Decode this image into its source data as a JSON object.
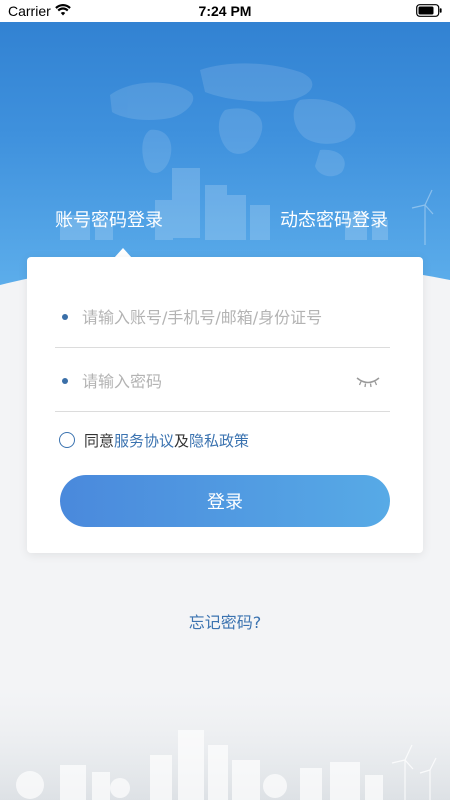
{
  "status_bar": {
    "carrier": "Carrier",
    "time": "7:24 PM"
  },
  "tabs": [
    {
      "label": "账号密码登录",
      "active": true
    },
    {
      "label": "动态密码登录",
      "active": false
    }
  ],
  "form": {
    "account_placeholder": "请输入账号/手机号/邮箱/身份证号",
    "password_placeholder": "请输入密码",
    "agree_prefix": "同意",
    "service_agreement": "服务协议",
    "and_text": "及",
    "privacy_policy": "隐私政策",
    "login_label": "登录"
  },
  "forgot_label": "忘记密码?",
  "colors": {
    "primary": "#3b73b0",
    "button_start": "#4a89dc",
    "button_end": "#57aae6",
    "header_top": "#2f7fd0"
  },
  "icons": {
    "wifi": "wifi-icon",
    "battery": "battery-icon",
    "eye_closed": "eye-closed-icon",
    "radio": "radio-unchecked-icon"
  }
}
